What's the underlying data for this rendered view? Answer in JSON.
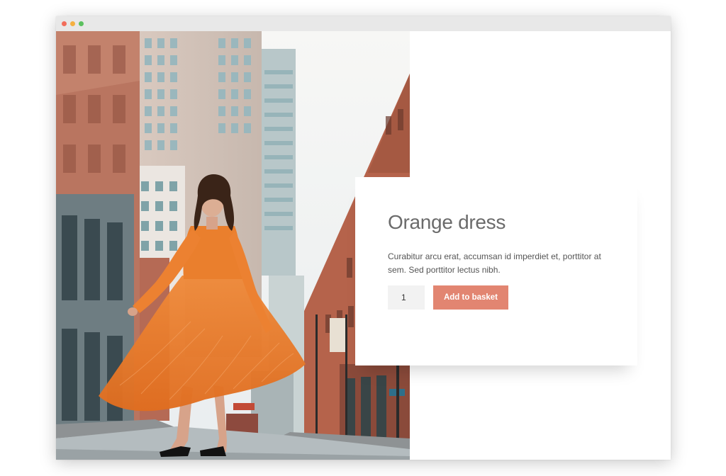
{
  "window": {
    "controls": [
      {
        "name": "close",
        "color": "#f26d5b"
      },
      {
        "name": "minimize",
        "color": "#f5b041"
      },
      {
        "name": "maximize",
        "color": "#5cc05f"
      }
    ]
  },
  "product": {
    "title": "Orange dress",
    "description": "Curabitur arcu erat, accumsan id imperdiet et, porttitor at sem. Sed porttitor lectus nibh.",
    "quantity": "1",
    "add_to_basket_label": "Add to basket",
    "image": "photo-woman-orange-dress-city-street"
  },
  "colors": {
    "button": "#e28571",
    "title": "#6b6b6b",
    "text": "#555555",
    "input_bg": "#f2f2f2"
  }
}
